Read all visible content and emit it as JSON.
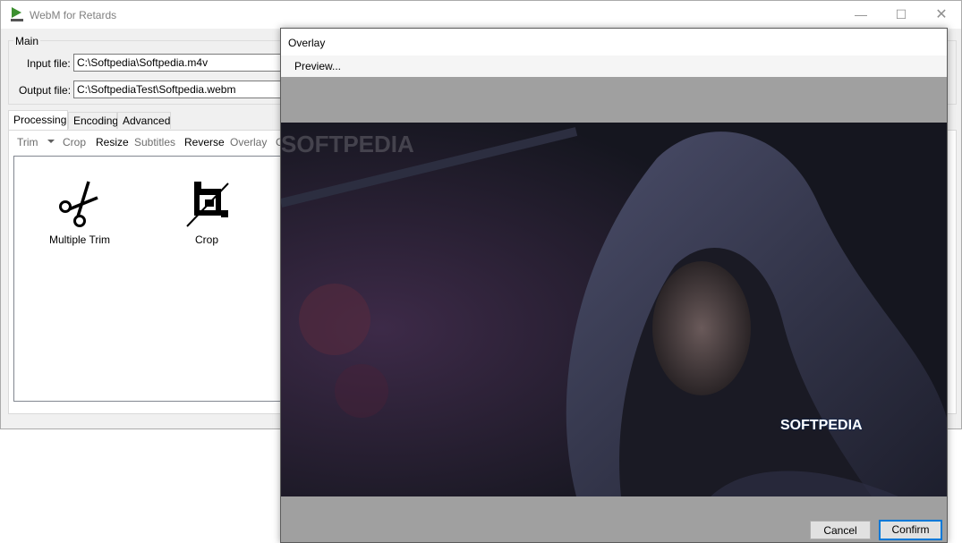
{
  "app": {
    "title": "WebM for Retards"
  },
  "main": {
    "group_label": "Main",
    "input_label": "Input file:",
    "input_value": "C:\\Softpedia\\Softpedia.m4v",
    "output_label": "Output file:",
    "output_value": "C:\\SoftpediaTest\\Softpedia.webm"
  },
  "tabs": [
    {
      "label": "Processing",
      "active": true
    },
    {
      "label": "Encoding"
    },
    {
      "label": "Advanced"
    }
  ],
  "toolbar": {
    "trim": "Trim",
    "crop": "Crop",
    "resize": "Resize",
    "subtitles": "Subtitles",
    "reverse": "Reverse",
    "overlay": "Overlay",
    "truncated": "C"
  },
  "tiles": [
    {
      "label": "Multiple Trim",
      "icon": "scissors-icon"
    },
    {
      "label": "Crop",
      "icon": "crop-icon"
    }
  ],
  "overlay_dialog": {
    "title": "Overlay",
    "menu_preview": "Preview...",
    "watermark_top": "SOFTPEDIA",
    "watermark_bottom": "SOFTPEDIA",
    "cancel": "Cancel",
    "confirm": "Confirm"
  },
  "colors": {
    "window_bg": "#f0f0f0",
    "dialog_bg": "#a0a0a0",
    "accent": "#0078d7",
    "video_bg": "#1b1c2a"
  }
}
